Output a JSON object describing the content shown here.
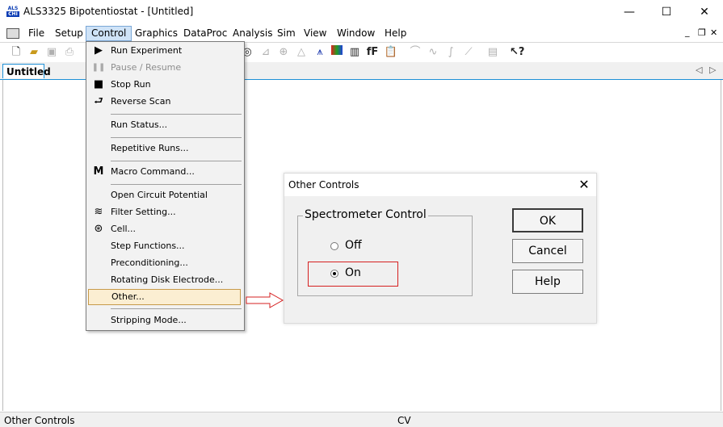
{
  "window": {
    "app_icon_top": "ALS",
    "app_icon_bottom": "CHI",
    "title": "ALS3325 Bipotentiostat - [Untitled]",
    "minimize": "—",
    "maximize": "☐",
    "close": "✕"
  },
  "menubar": {
    "items": [
      "File",
      "Setup",
      "Control",
      "Graphics",
      "DataProc",
      "Analysis",
      "Sim",
      "View",
      "Window",
      "Help"
    ],
    "mdi_minimize": "_",
    "mdi_restore": "❐",
    "mdi_close": "✕"
  },
  "toolbar": {
    "icons": [
      "new-file-icon",
      "open-folder-icon",
      "save-icon",
      "print-icon",
      "zoom-icon",
      "peak-icon",
      "graph-icon",
      "color-icon",
      "font-icon",
      "clipboard-icon",
      "smooth-icon",
      "derivative-icon",
      "integrate-icon",
      "fit-icon",
      "table-icon",
      "help-pointer-icon"
    ]
  },
  "tabs": {
    "active": "Untitled",
    "prev": "◁",
    "next": "▷"
  },
  "control_menu": {
    "items": [
      {
        "label": "Run Experiment",
        "icon": "▶",
        "icon_name": "play-icon",
        "enabled": true
      },
      {
        "label": "Pause / Resume",
        "icon": "❚❚",
        "icon_name": "pause-icon",
        "enabled": false
      },
      {
        "label": "Stop Run",
        "icon": "■",
        "icon_name": "stop-icon",
        "enabled": true
      },
      {
        "label": "Reverse Scan",
        "icon": "⮐",
        "icon_name": "reverse-icon",
        "enabled": true
      },
      {
        "label": "Run Status...",
        "icon": "",
        "icon_name": "",
        "enabled": true
      },
      {
        "label": "Repetitive Runs...",
        "icon": "",
        "icon_name": "",
        "enabled": true
      },
      {
        "label": "Macro Command...",
        "icon": "M",
        "icon_name": "macro-icon",
        "enabled": true
      },
      {
        "label": "Open Circuit Potential",
        "icon": "",
        "icon_name": "",
        "enabled": true
      },
      {
        "label": "Filter Setting...",
        "icon": "≋",
        "icon_name": "filter-icon",
        "enabled": true
      },
      {
        "label": "Cell...",
        "icon": "⊛",
        "icon_name": "cell-icon",
        "enabled": true
      },
      {
        "label": "Step Functions...",
        "icon": "",
        "icon_name": "",
        "enabled": true
      },
      {
        "label": "Preconditioning...",
        "icon": "",
        "icon_name": "",
        "enabled": true
      },
      {
        "label": "Rotating Disk Electrode...",
        "icon": "",
        "icon_name": "",
        "enabled": true
      },
      {
        "label": "Other...",
        "icon": "",
        "icon_name": "",
        "enabled": true
      },
      {
        "label": "Stripping Mode...",
        "icon": "",
        "icon_name": "",
        "enabled": true
      }
    ]
  },
  "dialog": {
    "title": "Other Controls",
    "close": "✕",
    "group_title": "Spectrometer Control",
    "options": [
      {
        "label": "Off",
        "selected": false
      },
      {
        "label": "On",
        "selected": true
      }
    ],
    "buttons": {
      "ok": "OK",
      "cancel": "Cancel",
      "help": "Help"
    }
  },
  "statusbar": {
    "left": "Other Controls",
    "middle": "CV"
  },
  "colors": {
    "menu_highlight": "#cfe3f7",
    "selected_item": "#fbeed2",
    "annotation_red": "#d62020",
    "tab_border": "#1e90d6"
  }
}
